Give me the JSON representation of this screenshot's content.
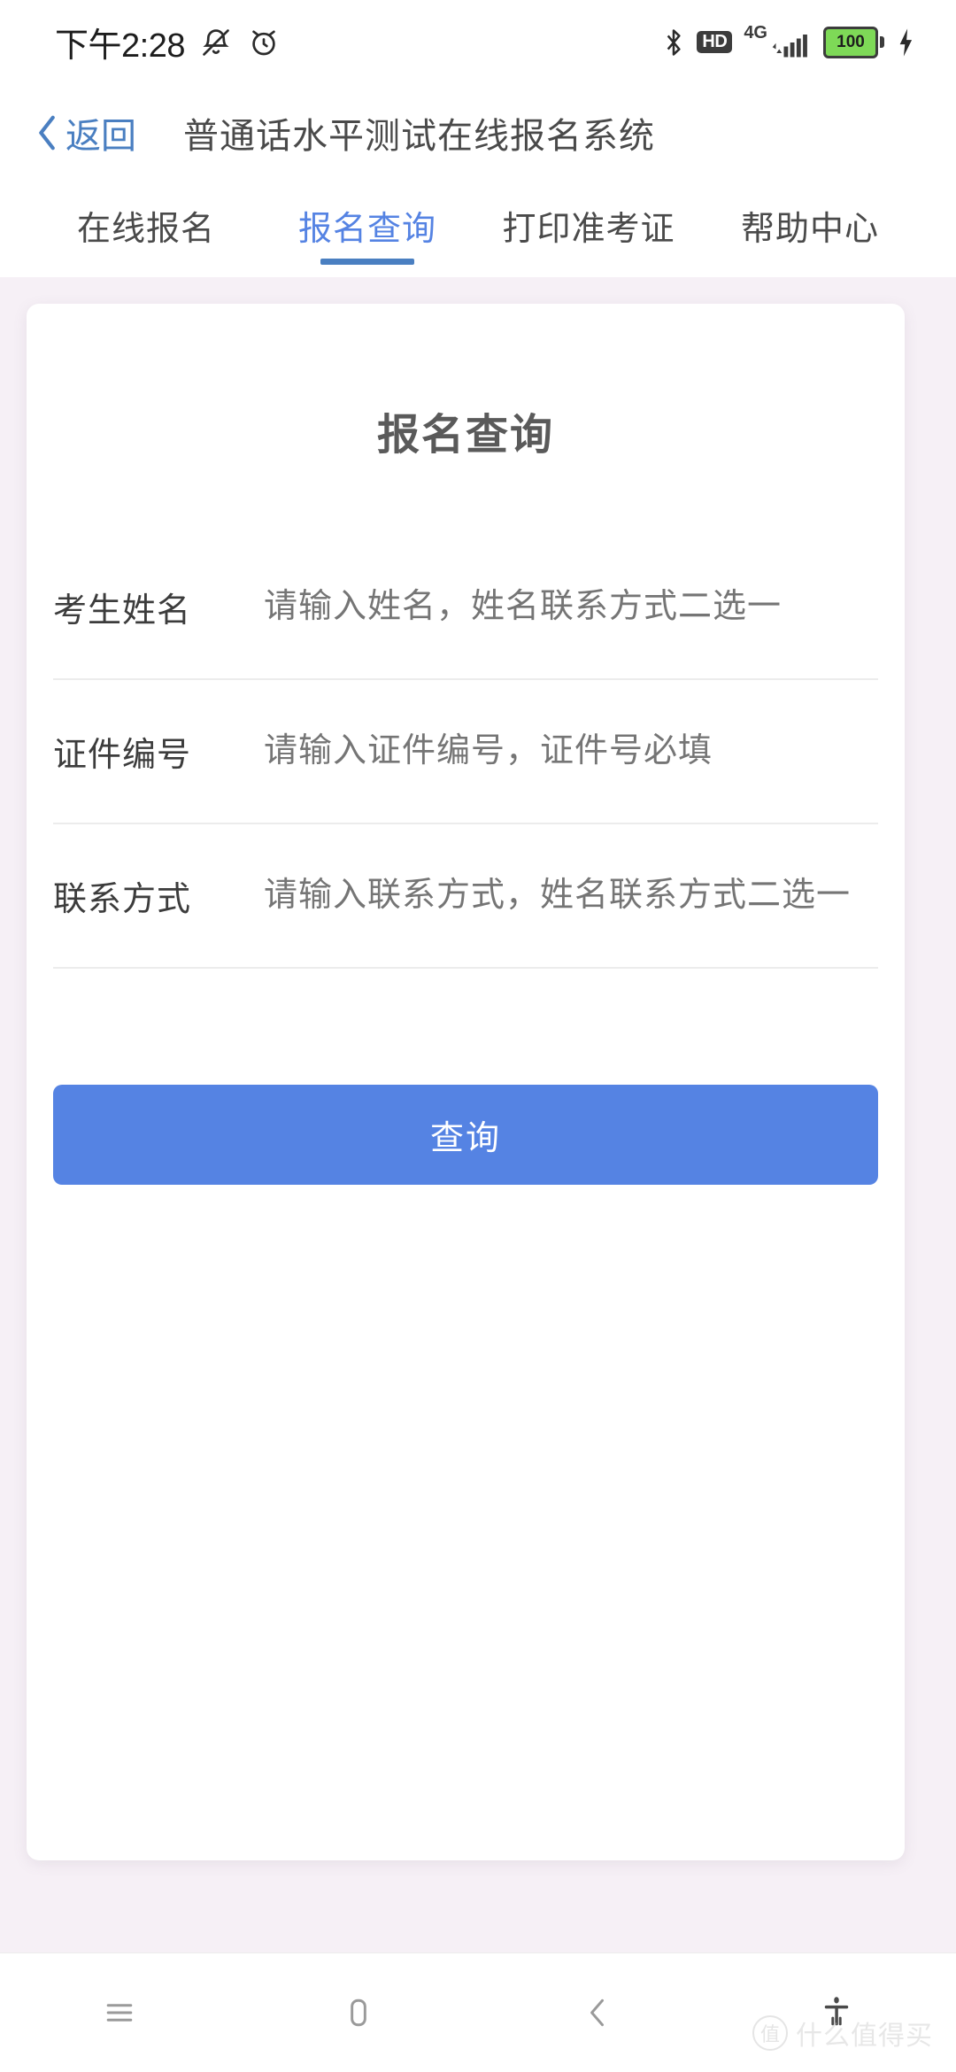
{
  "status_bar": {
    "time": "下午2:28",
    "mute_icon": "bell-mute-icon",
    "alarm_icon": "alarm-clock-icon",
    "bluetooth_icon": "bluetooth-icon",
    "hd_label": "HD",
    "network_label": "4G",
    "battery_level": "100",
    "charging_icon": "charging-bolt-icon"
  },
  "header": {
    "back_label": "返回",
    "back_icon": "chevron-left-icon",
    "title": "普通话水平测试在线报名系统"
  },
  "tabs": [
    {
      "label": "在线报名",
      "active": false
    },
    {
      "label": "报名查询",
      "active": true
    },
    {
      "label": "打印准考证",
      "active": false
    },
    {
      "label": "帮助中心",
      "active": false
    }
  ],
  "card": {
    "title": "报名查询",
    "fields": [
      {
        "label": "考生姓名",
        "value": "",
        "placeholder": "请输入姓名，姓名联系方式二选一"
      },
      {
        "label": "证件编号",
        "value": "",
        "placeholder": "请输入证件编号，证件号必填"
      },
      {
        "label": "联系方式",
        "value": "",
        "placeholder": "请输入联系方式，姓名联系方式二选一"
      }
    ],
    "submit_label": "查询"
  },
  "nav_bar": {
    "menu_icon": "menu-icon",
    "home_icon": "home-icon",
    "back_icon": "chevron-left-icon",
    "accessibility_icon": "accessibility-icon"
  },
  "watermark": {
    "logo_char": "值",
    "text": "什么值得买"
  },
  "colors": {
    "accent": "#5583e3",
    "tab_underline": "#4a7fc1",
    "page_background": "#f6f0f6",
    "battery_green": "#7ed957"
  }
}
